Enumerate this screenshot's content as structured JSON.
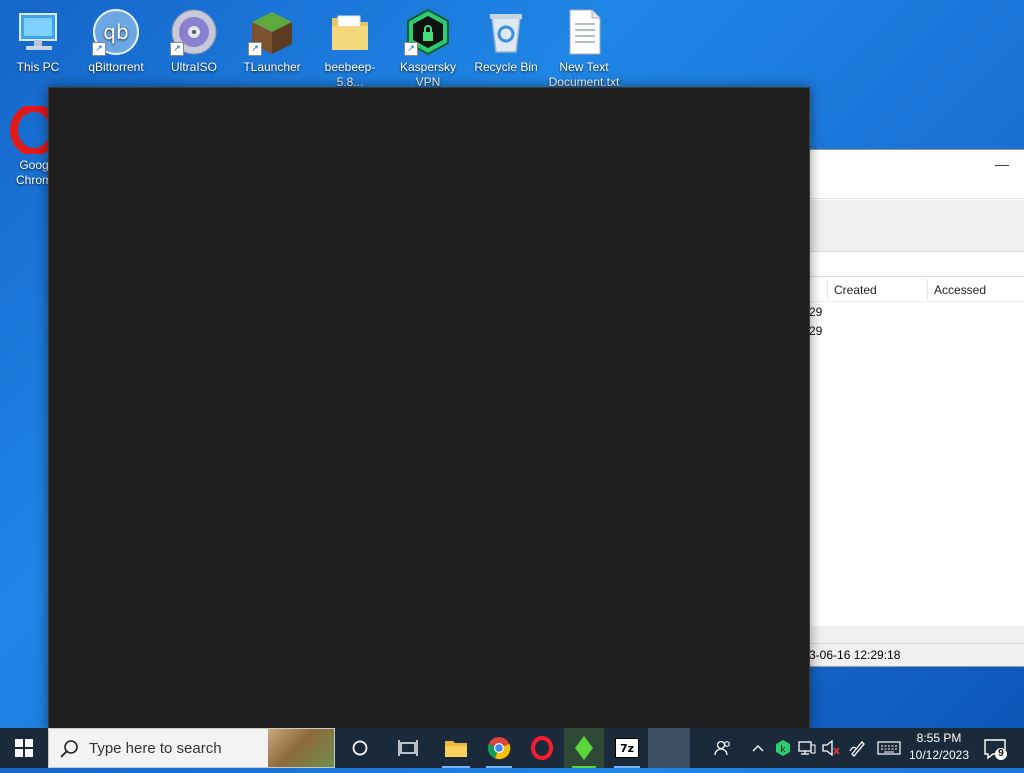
{
  "desktop": {
    "icons": [
      {
        "label": "This PC",
        "icon": "this-pc-icon"
      },
      {
        "label": "qBittorrent",
        "icon": "qbittorrent-icon"
      },
      {
        "label": "UltraISO",
        "icon": "ultraiso-icon"
      },
      {
        "label": "TLauncher",
        "icon": "tlauncher-icon"
      },
      {
        "label": "beebeep-5.8...",
        "icon": "folder-icon"
      },
      {
        "label": "Kaspersky VPN",
        "icon": "kaspersky-vpn-icon"
      },
      {
        "label": "Recycle Bin",
        "icon": "recycle-bin-icon"
      },
      {
        "label": "New Text Document.txt",
        "icon": "text-document-icon"
      },
      {
        "label": "Goog Chrom",
        "icon": "opera-icon"
      }
    ],
    "qb_glyph": "qb"
  },
  "background_window": {
    "minimize": "—",
    "columns": [
      "Created",
      "Accessed"
    ],
    "rows": [
      "29",
      "29"
    ],
    "status_text": "3-06-16 12:29:18"
  },
  "taskbar": {
    "search_placeholder": "Type here to search",
    "sevenzip_label": "7z",
    "clock_time": "8:55 PM",
    "clock_date": "10/12/2023",
    "notification_count": "9",
    "colors": {
      "taskbar": "#1b2a3a",
      "accent": "#7fb2f0",
      "dark_window": "#1f1f1f"
    }
  }
}
